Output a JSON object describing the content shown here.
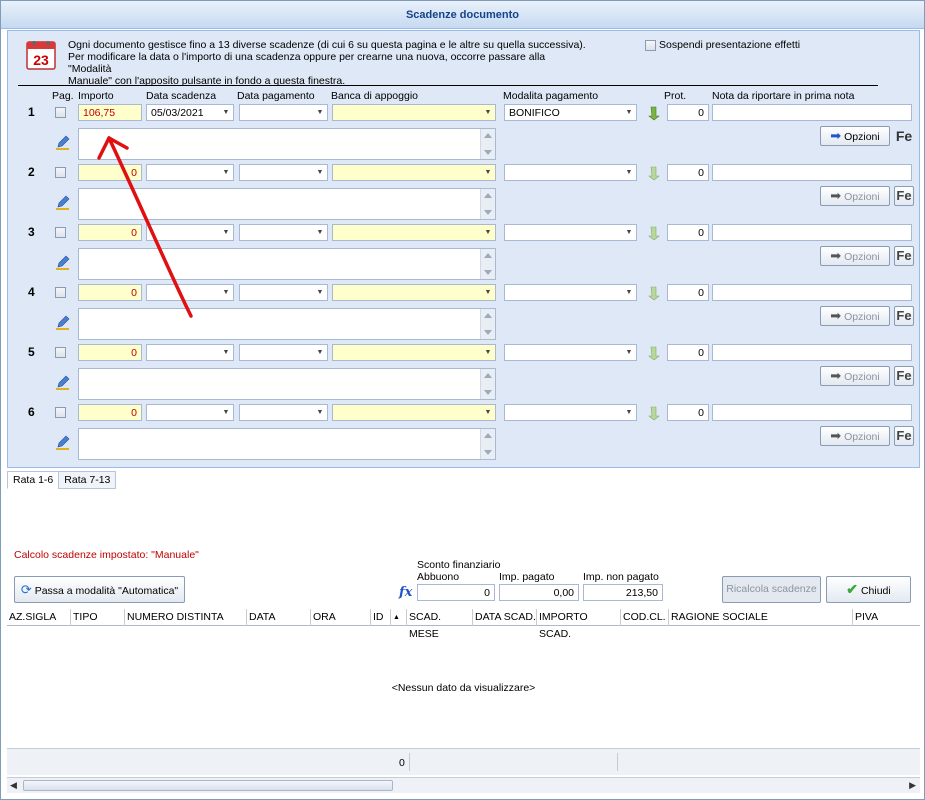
{
  "window": {
    "title": "Scadenze documento"
  },
  "info": {
    "line1": "Ogni documento gestisce fino a 13 diverse scadenze (di cui 6 su questa pagina e le altre su quella successiva).",
    "line2": "Per modificare la data o l'importo di una scadenza oppure per crearne una nuova, occorre passare alla \"Modalità",
    "line3": "Manuale\" con l'apposito pulsante in fondo a questa finestra.",
    "calendar_day": "23"
  },
  "suspend_checkbox": {
    "label": "Sospendi presentazione effetti"
  },
  "headers": {
    "pag": "Pag.",
    "importo": "Importo",
    "data_scadenza": "Data scadenza",
    "data_pagamento": "Data pagamento",
    "banca": "Banca di appoggio",
    "modalita": "Modalita pagamento",
    "prot": "Prot.",
    "nota": "Nota da riportare in prima nota"
  },
  "rows": [
    {
      "n": "1",
      "importo": "106,75",
      "data_scadenza": "05/03/2021",
      "modalita": "BONIFICO",
      "prot": "0",
      "opzioni": "Opzioni",
      "fe": "Fe"
    },
    {
      "n": "2",
      "importo": "0",
      "data_scadenza": "",
      "modalita": "",
      "prot": "0",
      "opzioni": "Opzioni",
      "fe": "Fe"
    },
    {
      "n": "3",
      "importo": "0",
      "data_scadenza": "",
      "modalita": "",
      "prot": "0",
      "opzioni": "Opzioni",
      "fe": "Fe"
    },
    {
      "n": "4",
      "importo": "0",
      "data_scadenza": "",
      "modalita": "",
      "prot": "0",
      "opzioni": "Opzioni",
      "fe": "Fe"
    },
    {
      "n": "5",
      "importo": "0",
      "data_scadenza": "",
      "modalita": "",
      "prot": "0",
      "opzioni": "Opzioni",
      "fe": "Fe"
    },
    {
      "n": "6",
      "importo": "0",
      "data_scadenza": "",
      "modalita": "",
      "prot": "0",
      "opzioni": "Opzioni",
      "fe": "Fe"
    }
  ],
  "tabs": [
    {
      "label": "Rata 1-6"
    },
    {
      "label": "Rata 7-13"
    }
  ],
  "calc_status": "Calcolo scadenze impostato: \"Manuale\"",
  "auto_button": "Passa a modalità \"Automatica\"",
  "totals": {
    "sconto_label": "Sconto finanziario",
    "abbuono_label": "Abbuono",
    "abbuono_value": "0",
    "imp_pagato_label": "Imp. pagato",
    "imp_pagato_value": "0,00",
    "imp_non_pagato_label": "Imp. non pagato",
    "imp_non_pagato_value": "213,50",
    "fx": "fx"
  },
  "buttons": {
    "ricalcola": "Ricalcola scadenze",
    "chiudi": "Chiudi"
  },
  "grid": {
    "columns": [
      "AZ.SIGLA",
      "TIPO",
      "NUMERO DISTINTA",
      "DATA",
      "ORA",
      "ID",
      "SCAD. MESE",
      "DATA SCAD.",
      "IMPORTO SCAD.",
      "COD.CL.",
      "RAGIONE SOCIALE",
      "PIVA"
    ],
    "empty": "<Nessun dato da visualizzare>",
    "footer_count": "0"
  },
  "colors": {
    "accent": "#15428b",
    "field_yellow": "#ffffcc",
    "panel": "#dfe8f6",
    "annotation_arrow": "#e01010"
  }
}
